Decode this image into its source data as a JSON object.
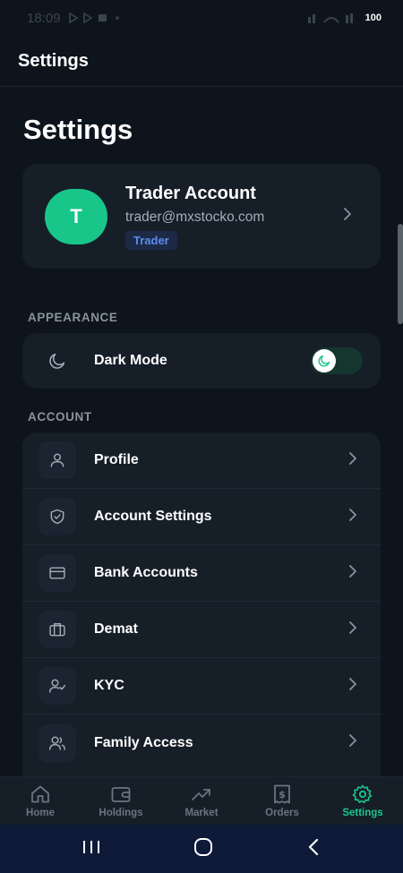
{
  "status_bar": {
    "time": "18:09",
    "battery": "100"
  },
  "header": {
    "title": "Settings"
  },
  "page": {
    "title": "Settings"
  },
  "profile": {
    "avatar_letter": "T",
    "name": "Trader Account",
    "email": "trader@mxstocko.com",
    "role_badge": "Trader"
  },
  "appearance": {
    "label": "APPEARANCE",
    "dark_mode_label": "Dark Mode",
    "dark_mode_on": true
  },
  "account": {
    "label": "ACCOUNT",
    "items": [
      {
        "label": "Profile",
        "icon": "user-icon"
      },
      {
        "label": "Account Settings",
        "icon": "shield-check-icon"
      },
      {
        "label": "Bank Accounts",
        "icon": "credit-card-icon"
      },
      {
        "label": "Demat",
        "icon": "briefcase-icon"
      },
      {
        "label": "KYC",
        "icon": "user-check-icon"
      },
      {
        "label": "Family Access",
        "icon": "users-icon"
      }
    ]
  },
  "nav": {
    "items": [
      {
        "label": "Home",
        "icon": "home-icon"
      },
      {
        "label": "Holdings",
        "icon": "wallet-icon"
      },
      {
        "label": "Market",
        "icon": "trending-up-icon"
      },
      {
        "label": "Orders",
        "icon": "receipt-icon"
      },
      {
        "label": "Settings",
        "icon": "gear-icon"
      }
    ],
    "active": "Settings"
  },
  "colors": {
    "background": "#0d141c",
    "card": "#161e28",
    "accent": "#19c68a",
    "badge_text": "#5a8cf0"
  }
}
